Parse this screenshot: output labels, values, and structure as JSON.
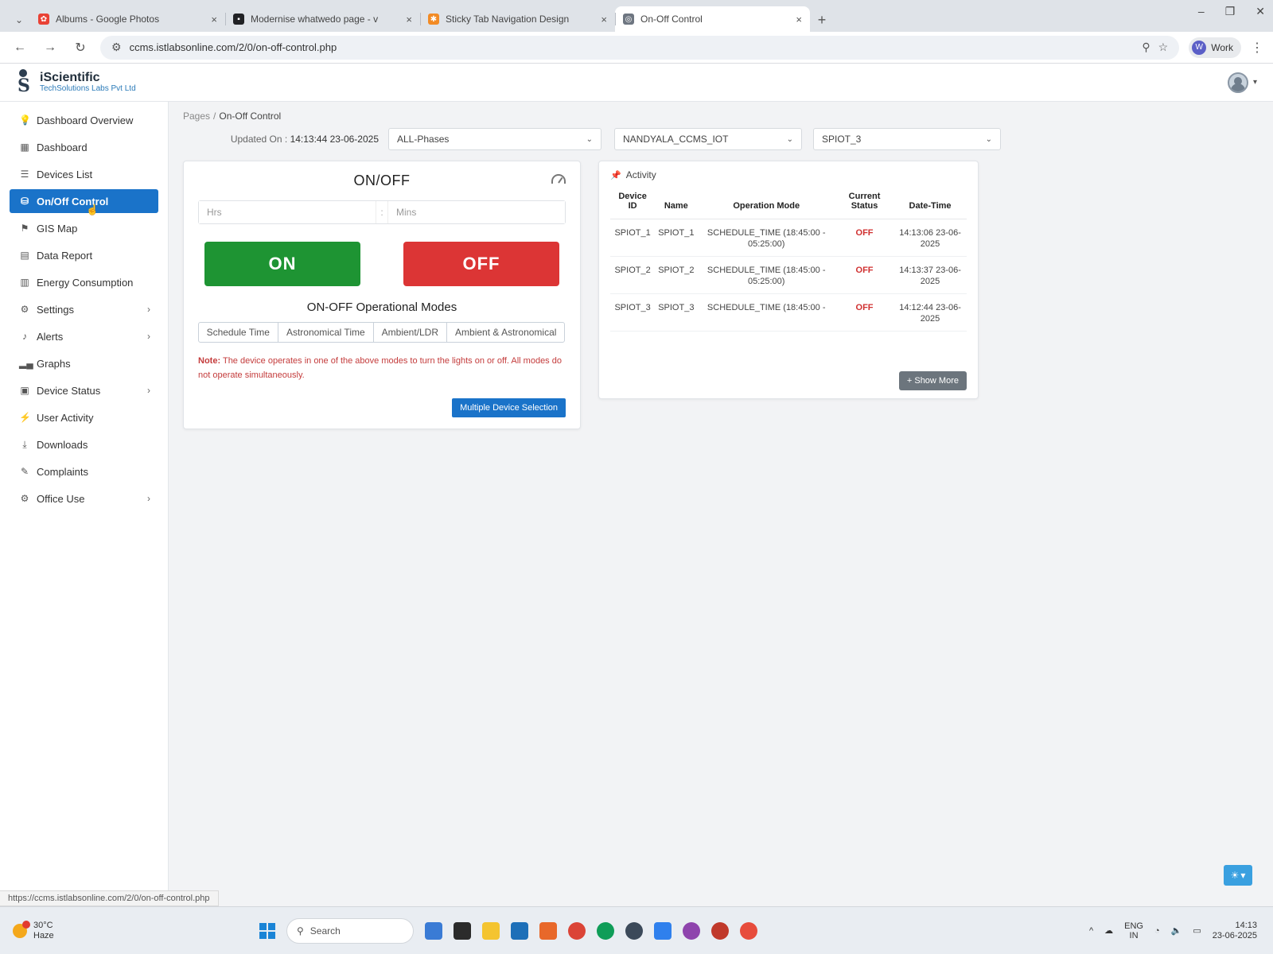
{
  "browser": {
    "tabs": [
      {
        "title": "Albums - Google Photos",
        "color": "#e94235",
        "icon": "photos-icon"
      },
      {
        "title": "Modernise whatwedo page - v",
        "color": "#202124",
        "icon": "doc-icon"
      },
      {
        "title": "Sticky Tab Navigation Design",
        "color": "#f28b25",
        "icon": "design-icon"
      },
      {
        "title": "On-Off Control",
        "color": "#6e7681",
        "icon": "globe-icon"
      }
    ],
    "url": "ccms.istlabsonline.com/2/0/on-off-control.php",
    "profile_label": "Work",
    "profile_initial": "W"
  },
  "brand": {
    "name": "iScientific",
    "sub": "TechSolutions Labs Pvt Ltd"
  },
  "sidebar": {
    "items": [
      {
        "label": "Dashboard Overview",
        "icon": "⚲"
      },
      {
        "label": "Dashboard",
        "icon": "▦"
      },
      {
        "label": "Devices List",
        "icon": "☰"
      },
      {
        "label": "On/Off Control",
        "icon": "⛁"
      },
      {
        "label": "GIS Map",
        "icon": "⚲"
      },
      {
        "label": "Data Report",
        "icon": "▤"
      },
      {
        "label": "Energy Consumption",
        "icon": "▥"
      },
      {
        "label": "Settings",
        "icon": "⚙"
      },
      {
        "label": "Alerts",
        "icon": "🔔"
      },
      {
        "label": "Graphs",
        "icon": "▁▃▅"
      },
      {
        "label": "Device Status",
        "icon": "▣"
      },
      {
        "label": "User Activity",
        "icon": "⚡"
      },
      {
        "label": "Downloads",
        "icon": "⤓"
      },
      {
        "label": "Complaints",
        "icon": "✎"
      },
      {
        "label": "Office Use",
        "icon": "⚙"
      }
    ],
    "active": "On/Off Control"
  },
  "breadcrumb": {
    "parent": "Pages",
    "sep": "/",
    "current": "On-Off Control"
  },
  "filters": {
    "updated_label": "Updated On :",
    "updated_value": "14:13:44 23-06-2025",
    "phase": "ALL-Phases",
    "zone": "NANDYALA_CCMS_IOT",
    "device": "SPIOT_3"
  },
  "onoff": {
    "title": "ON/OFF",
    "hrs_placeholder": "Hrs",
    "mins_placeholder": "Mins",
    "colon": ":",
    "on_label": "ON",
    "off_label": "OFF",
    "modes_title": "ON-OFF Operational Modes",
    "modes": [
      "Schedule Time",
      "Astronomical Time",
      "Ambient/LDR",
      "Ambient & Astronomical"
    ],
    "note_label": "Note:",
    "note_text": "The device operates in one of the above modes to turn the lights on or off. All modes do not operate simultaneously.",
    "multi_button": "Multiple Device Selection"
  },
  "activity": {
    "title": "Activity",
    "columns": [
      "Device ID",
      "Name",
      "Operation Mode",
      "Current Status",
      "Date-Time"
    ],
    "rows": [
      [
        "SPIOT_1",
        "SPIOT_1",
        "SCHEDULE_TIME (18:45:00 - 05:25:00)",
        "OFF",
        "14:13:06 23-06-2025"
      ],
      [
        "SPIOT_2",
        "SPIOT_2",
        "SCHEDULE_TIME (18:45:00 - 05:25:00)",
        "OFF",
        "14:13:37 23-06-2025"
      ],
      [
        "SPIOT_3",
        "SPIOT_3",
        "SCHEDULE_TIME (18:45:00 -",
        "OFF",
        "14:12:44 23-06-2025"
      ]
    ],
    "show_more": "+ Show More"
  },
  "status_url": "https://ccms.istlabsonline.com/2/0/on-off-control.php",
  "taskbar": {
    "temp": "30°C",
    "weather": "Haze",
    "search": "Search",
    "lang_top": "ENG",
    "lang_bottom": "IN",
    "time": "14:13",
    "date": "23-06-2025",
    "app_colors": [
      "#3a7bd5",
      "#2b2b2b",
      "#f4c430",
      "#1d6fb8",
      "#e8682a",
      "#db4437",
      "#0f9d58",
      "#3c4a5a",
      "#2f80ed",
      "#8e44ad",
      "#c0392b",
      "#e74c3c"
    ]
  }
}
